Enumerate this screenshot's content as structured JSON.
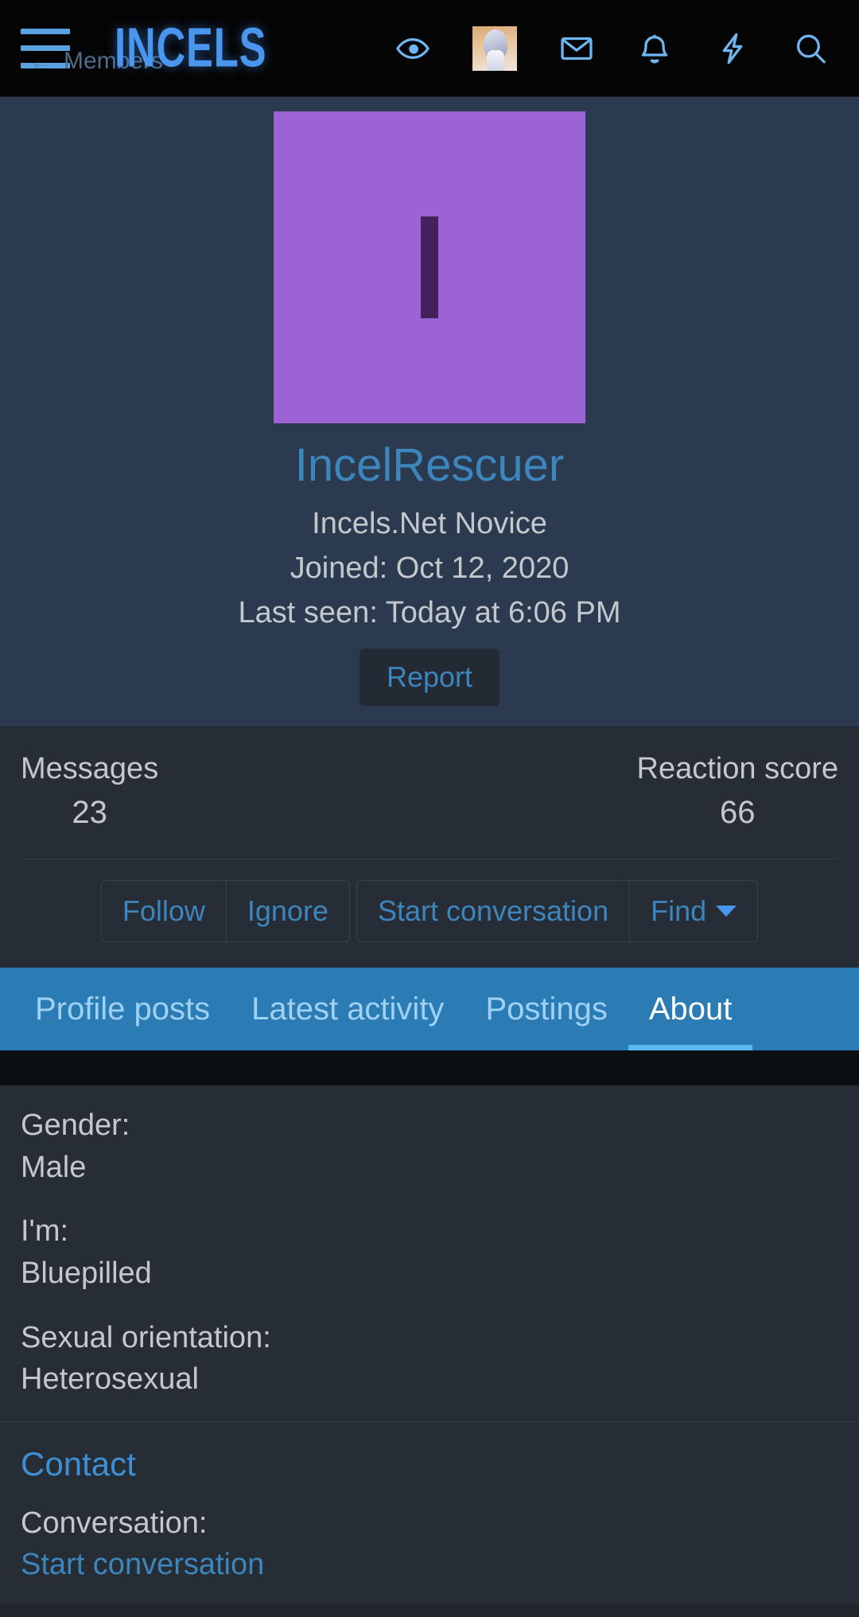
{
  "header": {
    "menu_label": "menu",
    "brand": "INCELS",
    "breadcrumb_back": "←",
    "breadcrumb_label": "Members",
    "icons": [
      {
        "name": "eye-icon",
        "label": "What's new"
      },
      {
        "name": "user-avatar-thumb",
        "label": "Account"
      },
      {
        "name": "envelope-icon",
        "label": "Inbox"
      },
      {
        "name": "bell-icon",
        "label": "Alerts"
      },
      {
        "name": "bolt-icon",
        "label": "Quick links"
      },
      {
        "name": "search-icon",
        "label": "Search"
      }
    ]
  },
  "profile": {
    "avatar_letter": "I",
    "avatar_bg": "#9b63d3",
    "avatar_letter_color": "#44215c",
    "username": "IncelRescuer",
    "username_color": "#3d85bd",
    "user_title": "Incels.Net Novice",
    "joined": "Joined: Oct 12, 2020",
    "last_seen": "Last seen: Today at 6:06 PM",
    "report_label": "Report"
  },
  "stats": [
    {
      "label": "Messages",
      "value": "23"
    },
    {
      "label": "Reaction score",
      "value": "66"
    }
  ],
  "actions": {
    "group_one": [
      {
        "label": "Follow"
      },
      {
        "label": "Ignore"
      }
    ],
    "group_two": [
      {
        "label": "Start conversation"
      },
      {
        "label": "Find",
        "caret": true
      }
    ]
  },
  "tabs": [
    {
      "label": "Profile posts",
      "active": false
    },
    {
      "label": "Latest activity",
      "active": false
    },
    {
      "label": "Postings",
      "active": false
    },
    {
      "label": "About",
      "active": true
    }
  ],
  "about": {
    "rows": [
      {
        "label": "Gender:",
        "value": "Male"
      },
      {
        "label": "I'm:",
        "value": "Bluepilled"
      },
      {
        "label": "Sexual orientation:",
        "value": "Heterosexual"
      }
    ]
  },
  "contact": {
    "heading": "Contact",
    "label": "Conversation:",
    "link": "Start conversation"
  },
  "colors": {
    "page_bg": "#22272e",
    "header_bg": "#050505",
    "banner_bg": "#2b3a4f",
    "card_bg": "#272d35",
    "tab_bar_bg": "#2b7cb5",
    "accent_blue": "#4a95ee",
    "link_blue": "#3d85bd",
    "text_gray": "#c3c8cd"
  }
}
